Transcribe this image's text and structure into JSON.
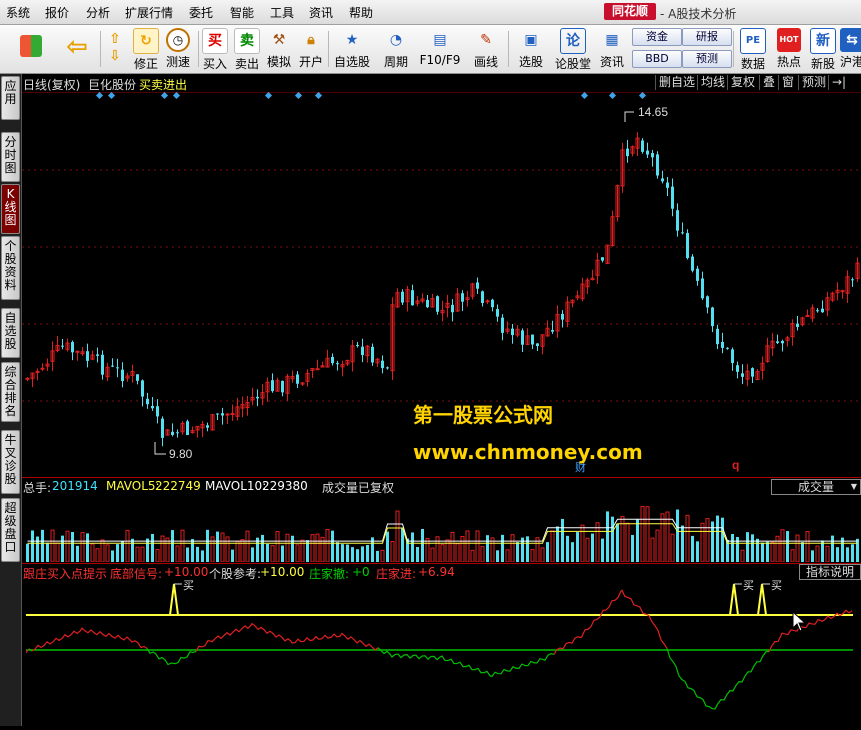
{
  "menu": [
    "系统",
    "报价",
    "分析",
    "扩展行情",
    "委托",
    "智能",
    "工具",
    "资讯",
    "帮助"
  ],
  "brand": "同花顺",
  "app_title": "- A股技术分析",
  "toolbar": {
    "buttons": [
      {
        "label": "修正",
        "icon": "refresh-arrows-icon"
      },
      {
        "label": "测速",
        "icon": "clock-icon"
      },
      {
        "label": "买入",
        "icon": "buy-icon",
        "glyph": "买"
      },
      {
        "label": "卖出",
        "icon": "sell-icon",
        "glyph": "卖"
      },
      {
        "label": "模拟",
        "icon": "hammer-icon"
      },
      {
        "label": "开户",
        "icon": "lock-icon"
      },
      {
        "label": "自选股",
        "icon": "star-icon"
      },
      {
        "label": "周期",
        "icon": "cycle-icon"
      },
      {
        "label": "F10/F9",
        "icon": "f10-icon"
      },
      {
        "label": "画线",
        "icon": "pencil-icon"
      },
      {
        "label": "选股",
        "icon": "screen-icon"
      },
      {
        "label": "论股堂",
        "icon": "forum-icon",
        "glyph": "论"
      },
      {
        "label": "资讯",
        "icon": "news-icon"
      },
      {
        "label": "数据",
        "icon": "pe-icon",
        "glyph": "PE"
      },
      {
        "label": "热点",
        "icon": "hot-icon",
        "glyph": "HOT"
      },
      {
        "label": "新股",
        "icon": "new-stock-icon",
        "glyph": "新"
      },
      {
        "label": "沪港",
        "icon": "hk-icon"
      }
    ],
    "mini": [
      "资金",
      "研报",
      "BBD",
      "预测"
    ]
  },
  "left_tabs": [
    "应用",
    "分时图",
    "K线图",
    "个股资料",
    "自选股",
    "综合排名",
    "牛叉诊股",
    "超级盘口"
  ],
  "chart_header": {
    "period": "日线(复权)",
    "stock": "巨化股份",
    "indicator": "买卖进出",
    "right_buttons": [
      "删自选",
      "均线",
      "复权",
      "叠",
      "窗",
      "预测",
      "→|"
    ]
  },
  "price_labels": {
    "high": "14.65",
    "low": "9.80"
  },
  "markers": {
    "fin": "财",
    "q": "q"
  },
  "volume": {
    "total_label": "总手:",
    "total": "201914",
    "mavol5_label": "MAVOL5:",
    "mavol5": "222749",
    "mavol10_label": "MAVOL10:",
    "mavol10": "229380",
    "note": "成交量已复权",
    "dropdown": "成交量"
  },
  "indicator": {
    "title": "跟庄买入点提示",
    "bottom_label": "底部信号:",
    "bottom_val": "+10.00",
    "ref_label": "个股参考:",
    "ref_val": "+10.00",
    "withdraw_label": "庄家撤:",
    "withdraw_val": "+0",
    "enter_label": "庄家进:",
    "enter_val": "+6.94",
    "explain": "指标说明",
    "buy_label": "买"
  },
  "watermark": {
    "line1": "第一股票公式网",
    "line2": "www.chnmoney.com"
  },
  "colors": {
    "up": "#e02020",
    "down": "#54e0f0",
    "yellow": "#ffff40",
    "green": "#00c000",
    "marker": "#3fa3e8"
  }
}
